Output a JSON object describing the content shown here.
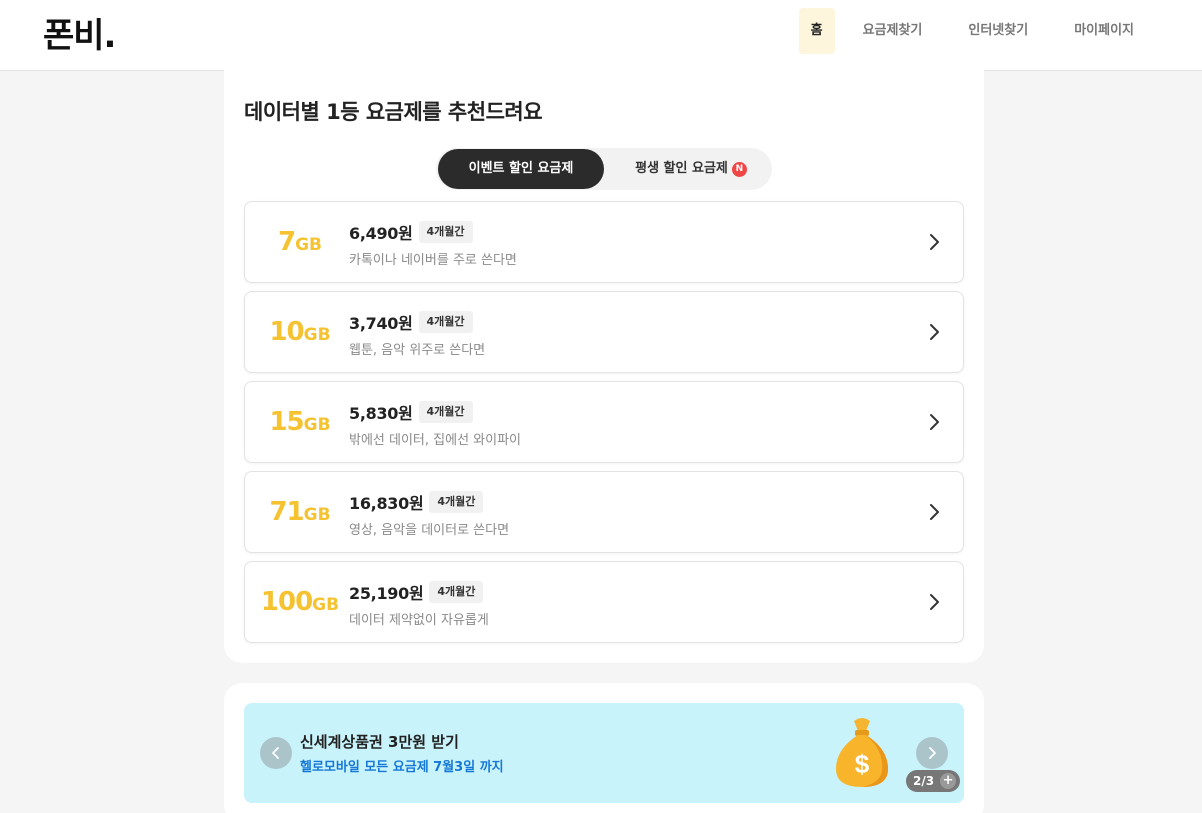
{
  "header": {
    "logo": "폰비.",
    "nav": [
      "홈",
      "요금제찾기",
      "인터넷찾기",
      "마이페이지"
    ]
  },
  "main": {
    "title": "데이터별 1등 요금제를 추천드려요",
    "tabs": [
      {
        "label": "이벤트 할인 요금제",
        "active": true
      },
      {
        "label": "평생 할인 요금제",
        "badge": "N",
        "active": false
      }
    ],
    "plans": [
      {
        "gb": "7",
        "unit": "GB",
        "price": "6,490원",
        "badge": "4개월간",
        "desc": "카톡이나 네이버를 주로 쓴다면"
      },
      {
        "gb": "10",
        "unit": "GB",
        "price": "3,740원",
        "badge": "4개월간",
        "desc": "웹툰, 음악 위주로 쓴다면"
      },
      {
        "gb": "15",
        "unit": "GB",
        "price": "5,830원",
        "badge": "4개월간",
        "desc": "밖에선 데이터, 집에선 와이파이"
      },
      {
        "gb": "71",
        "unit": "GB",
        "price": "16,830원",
        "badge": "4개월간",
        "desc": "영상, 음악을 데이터로 쓴다면"
      },
      {
        "gb": "100",
        "unit": "GB",
        "price": "25,190원",
        "badge": "4개월간",
        "desc": "데이터 제약없이 자유롭게"
      }
    ]
  },
  "promo": {
    "title": "신세계상품권 3만원 받기",
    "subtitle": "헬로모바일 모든 요금제 7월3일 까지",
    "pager": "2/3",
    "pager_plus": "+",
    "icon": "money-bag-icon"
  },
  "colors": {
    "accent_yellow": "#f5c232",
    "promo_bg": "#c8f3fb",
    "promo_link": "#1678d6",
    "tab_active": "#2b2b2b",
    "new_badge": "#ef4747"
  }
}
